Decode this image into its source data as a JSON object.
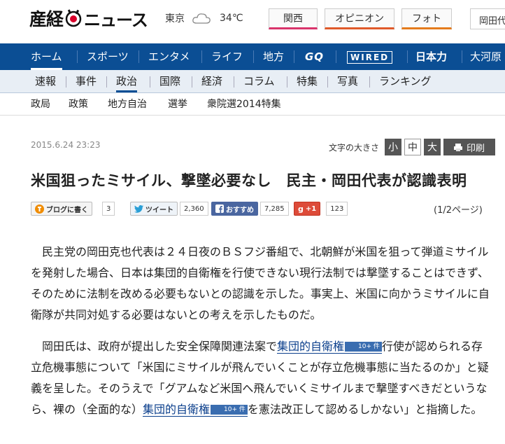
{
  "header": {
    "logo_part1": "産経",
    "logo_part2": "ニュース",
    "weather_city": "東京",
    "weather_temp": "34℃",
    "tabs": [
      "関西",
      "オピニオン",
      "フォト"
    ],
    "search_text": "岡田代"
  },
  "nav_main": {
    "items": [
      "ホーム",
      "スポーツ",
      "エンタメ",
      "ライフ",
      "地方",
      "GQ",
      "WIRED",
      "日本力",
      "大河原"
    ]
  },
  "nav_sub": {
    "items": [
      "速報",
      "事件",
      "政治",
      "国際",
      "経済",
      "コラム",
      "特集",
      "写真",
      "ランキング"
    ]
  },
  "nav_sub2": {
    "items": [
      "政局",
      "政策",
      "地方自治",
      "選挙",
      "衆院選2014特集"
    ]
  },
  "article": {
    "date": "2015.6.24 23:23",
    "font_size_label": "文字の大きさ",
    "font_small": "小",
    "font_mid": "中",
    "font_large": "大",
    "print": "印刷",
    "headline": "米国狙ったミサイル、撃墜必要なし　民主・岡田代表が認識表明",
    "page_indicator": "(1/2ページ)",
    "social": {
      "blog_label": "ブログに書く",
      "blog_count": "3",
      "tweet_label": "ツイート",
      "tweet_count": "2,360",
      "fb_label": "おすすめ",
      "fb_count": "7,285",
      "gplus_label": "+1",
      "gplus_count": "123"
    },
    "para1": "民主党の岡田克也代表は２４日夜のＢＳフジ番組で、北朝鮮が米国を狙って弾道ミサイルを発射した場合、日本は集団的自衛権を行使できない現行法制では撃墜することはできず、そのために法制を改める必要もないとの認識を示した。事実上、米国に向かうミサイルに自衛隊が共同対処する必要はないとの考えを示したものだ。",
    "para2_a": "岡田氏は、政府が提出した安全保障関連法案で",
    "keyword": "集団的自衛権",
    "keyword_badge": "10+ 件",
    "para2_b": "行使が認められる存立危機事態について「米国にミサイルが飛んでいくことが存立危機事態に当たるのか」と疑義を呈した。そのうえで「グアムなど米国へ飛んでいくミサイルまで撃墜すべきだというなら、裸の（全面的な）",
    "para2_c": "を憲法改正して認めるしかない」と指摘した。"
  }
}
